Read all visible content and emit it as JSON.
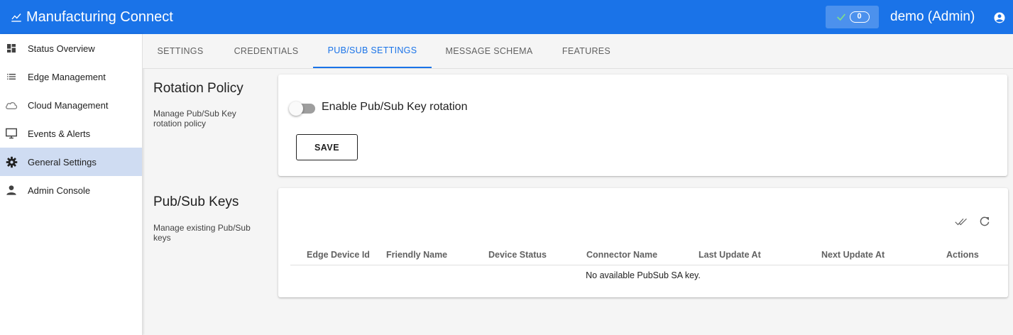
{
  "header": {
    "title": "Manufacturing Connect",
    "status_count": "0",
    "user": "demo (Admin)",
    "icons": {
      "brand": "chart-line-icon",
      "status": "check-icon",
      "account": "account-circle-icon"
    },
    "colors": {
      "bar": "#1a73e8"
    }
  },
  "sidebar": {
    "items": [
      {
        "label": "Status Overview",
        "icon": "dashboard-icon"
      },
      {
        "label": "Edge Management",
        "icon": "list-icon"
      },
      {
        "label": "Cloud Management",
        "icon": "cloud-icon"
      },
      {
        "label": "Events & Alerts",
        "icon": "monitor-icon"
      },
      {
        "label": "General Settings",
        "icon": "gear-icon",
        "active": true
      },
      {
        "label": "Admin Console",
        "icon": "person-icon"
      }
    ],
    "active_color": "#cfdcf2"
  },
  "tabs": [
    {
      "label": "SETTINGS"
    },
    {
      "label": "CREDENTIALS"
    },
    {
      "label": "PUB/SUB SETTINGS",
      "active": true
    },
    {
      "label": "MESSAGE SCHEMA"
    },
    {
      "label": "FEATURES"
    }
  ],
  "rotation": {
    "title": "Rotation Policy",
    "description": "Manage Pub/Sub Key rotation policy",
    "toggle_label": "Enable Pub/Sub Key rotation",
    "toggle_enabled": false,
    "save_label": "SAVE"
  },
  "keys": {
    "title": "Pub/Sub Keys",
    "description": "Manage existing Pub/Sub keys",
    "tool_icons": [
      "done-all-icon",
      "refresh-icon"
    ],
    "columns": [
      "Edge Device Id",
      "Friendly Name",
      "Device Status",
      "Connector Name",
      "Last Update At",
      "Next Update At",
      "Actions"
    ],
    "rows": [],
    "empty_message": "No available PubSub SA key."
  }
}
